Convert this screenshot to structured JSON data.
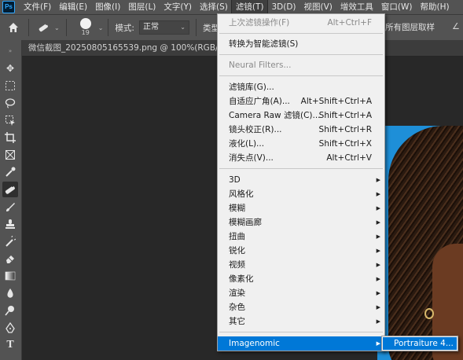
{
  "app": {
    "logo_text": "Ps"
  },
  "menubar": {
    "items": [
      "文件(F)",
      "编辑(E)",
      "图像(I)",
      "图层(L)",
      "文字(Y)",
      "选择(S)",
      "滤镜(T)",
      "3D(D)",
      "视图(V)",
      "增效工具",
      "窗口(W)",
      "帮助(H)"
    ],
    "active_index": 6
  },
  "options": {
    "brush_size": "19",
    "mode_label": "模式:",
    "mode_value": "正常",
    "type_label": "类型:",
    "sample_all_layers": "所有图层取样"
  },
  "document": {
    "tab_title": "微信截图_20250805165539.png @ 100%(RGB/8#)"
  },
  "filter_menu": {
    "last_filter": {
      "label": "上次滤镜操作(F)",
      "shortcut": "Alt+Ctrl+F"
    },
    "convert_smart": "转换为智能滤镜(S)",
    "neural_filters": "Neural Filters...",
    "group1": [
      {
        "label": "滤镜库(G)...",
        "shortcut": ""
      },
      {
        "label": "自适应广角(A)...",
        "shortcut": "Alt+Shift+Ctrl+A"
      },
      {
        "label": "Camera Raw 滤镜(C)...",
        "shortcut": "Shift+Ctrl+A"
      },
      {
        "label": "镜头校正(R)...",
        "shortcut": "Shift+Ctrl+R"
      },
      {
        "label": "液化(L)...",
        "shortcut": "Shift+Ctrl+X"
      },
      {
        "label": "消失点(V)...",
        "shortcut": "Alt+Ctrl+V"
      }
    ],
    "submenus": [
      "3D",
      "风格化",
      "模糊",
      "模糊画廊",
      "扭曲",
      "锐化",
      "视频",
      "像素化",
      "渲染",
      "杂色",
      "其它"
    ],
    "plugins": [
      {
        "label": "Imagenomic",
        "highlighted": true
      }
    ]
  },
  "submenu": {
    "items": [
      "Portraiture 4..."
    ]
  },
  "colors": {
    "menu_highlight": "#0078d7",
    "panel_bg": "#535353",
    "canvas_bg": "#282828",
    "image_bg": "#1e8fd8"
  }
}
